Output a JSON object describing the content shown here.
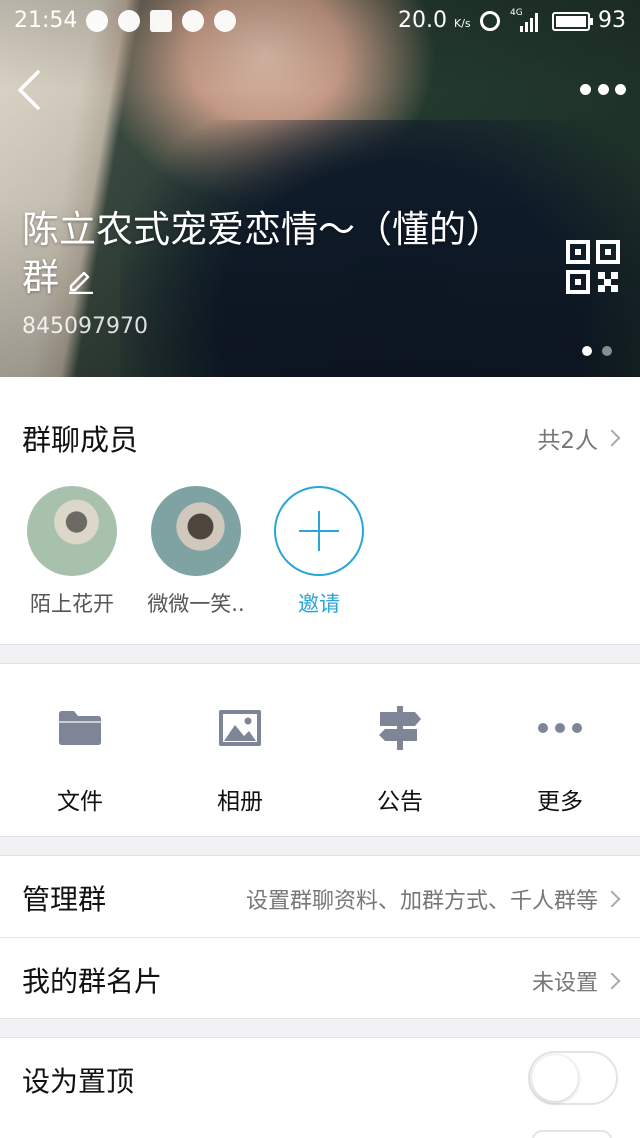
{
  "status_bar": {
    "time": "21:54",
    "speed": "20.0",
    "speed_unit": "K/s",
    "network": "4G",
    "battery": "93"
  },
  "header": {
    "group_name": "陈立农式宠爱恋情～（懂的）群",
    "group_number": "845097970",
    "back_icon": "back-arrow-icon",
    "more_icon": "more-dots-icon",
    "qr_icon": "qr-code-icon"
  },
  "members_section": {
    "title": "群聊成员",
    "count": "共2人",
    "members": [
      {
        "name": "陌上花开"
      },
      {
        "name": "微微一笑.."
      }
    ],
    "invite_label": "邀请"
  },
  "actions": [
    {
      "label": "文件",
      "icon": "folder-icon"
    },
    {
      "label": "相册",
      "icon": "photo-icon"
    },
    {
      "label": "公告",
      "icon": "signpost-icon"
    },
    {
      "label": "更多",
      "icon": "more-dots-icon"
    }
  ],
  "manage_group": {
    "label": "管理群",
    "value": "设置群聊资料、加群方式、千人群等"
  },
  "my_card": {
    "label": "我的群名片",
    "value": "未设置"
  },
  "pin_top": {
    "label": "设为置顶",
    "enabled": false
  },
  "colors": {
    "accent": "#2aa6d6",
    "icon_gray": "#7d8597"
  }
}
